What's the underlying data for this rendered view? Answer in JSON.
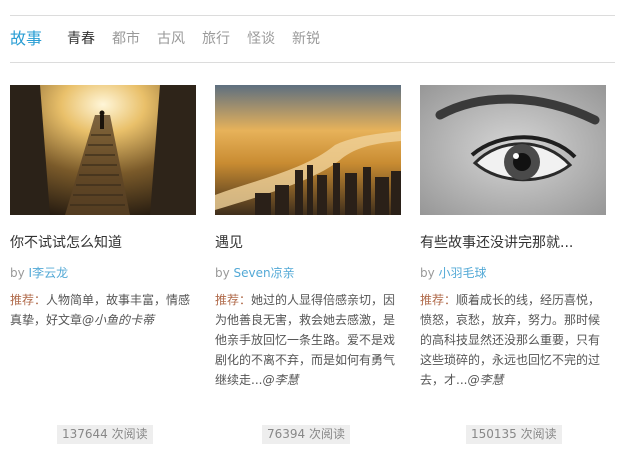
{
  "nav": {
    "tabs": [
      {
        "label": "故事"
      },
      {
        "label": "青春"
      },
      {
        "label": "都市"
      },
      {
        "label": "古风"
      },
      {
        "label": "旅行"
      },
      {
        "label": "怪谈"
      },
      {
        "label": "新锐"
      }
    ]
  },
  "cards": [
    {
      "title": "你不试试怎么知道",
      "by_prefix": "by",
      "author": "I李云龙",
      "rec_label": "推荐：",
      "rec_text": "人物简单，故事丰富，情感真挚，好文章",
      "rec_signature": "@小鱼的卡蒂",
      "reads": "137644 次阅读"
    },
    {
      "title": "遇见",
      "by_prefix": "by",
      "author": "Seven凉亲",
      "rec_label": "推荐：",
      "rec_text": "她过的人显得倍感亲切，因为他善良无害，救会她去感激，是他亲手放回忆一条生路。爱不是戏剧化的不离不弃，而是如何有勇气继续走...",
      "rec_signature": "@李慧",
      "reads": "76394 次阅读"
    },
    {
      "title": "有些故事还没讲完那就...",
      "by_prefix": "by",
      "author": "小羽毛球",
      "rec_label": "推荐：",
      "rec_text": "顺着成长的线，经历喜悦，愤怒，哀愁，放弃，努力。那时候的高科技显然还没那么重要，只有这些琐碎的，永远也回忆不完的过去，才...",
      "rec_signature": "@李慧",
      "reads": "150135 次阅读"
    }
  ]
}
